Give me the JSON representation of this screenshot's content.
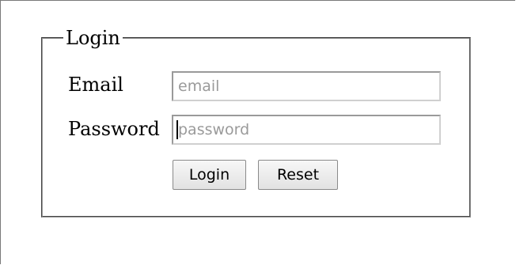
{
  "form": {
    "legend": "Login",
    "email": {
      "label": "Email",
      "placeholder": "email",
      "value": ""
    },
    "password": {
      "label": "Password",
      "placeholder": "password",
      "value": ""
    },
    "buttons": {
      "login_label": "Login",
      "reset_label": "Reset"
    }
  }
}
